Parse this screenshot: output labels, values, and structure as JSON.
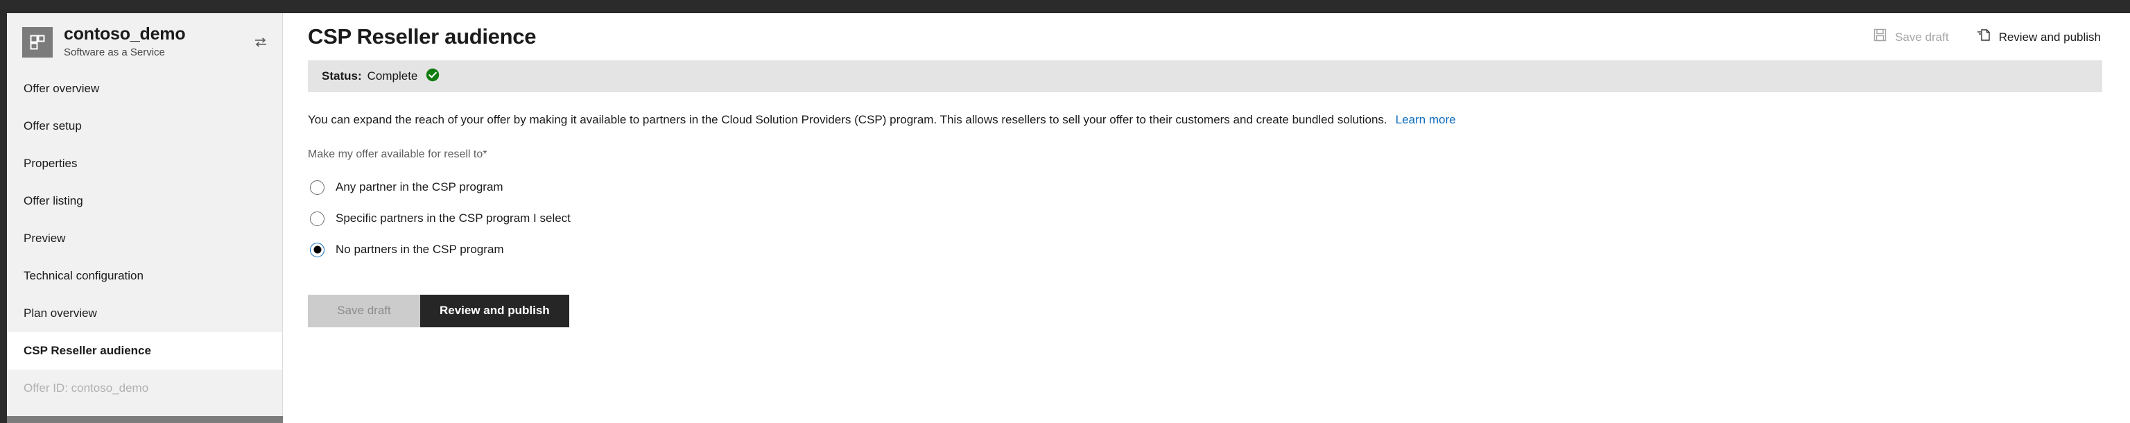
{
  "sidebar": {
    "app_icon_name": "offer-grid-icon",
    "app_name": "contoso_demo",
    "app_subtitle": "Software as a Service",
    "collapse_icon_name": "collapse-panel-icon",
    "items": [
      {
        "label": "Offer overview",
        "selected": false,
        "muted": false
      },
      {
        "label": "Offer setup",
        "selected": false,
        "muted": false
      },
      {
        "label": "Properties",
        "selected": false,
        "muted": false
      },
      {
        "label": "Offer listing",
        "selected": false,
        "muted": false
      },
      {
        "label": "Preview",
        "selected": false,
        "muted": false
      },
      {
        "label": "Technical configuration",
        "selected": false,
        "muted": false
      },
      {
        "label": "Plan overview",
        "selected": false,
        "muted": false
      },
      {
        "label": "CSP Reseller audience",
        "selected": true,
        "muted": false
      },
      {
        "label": "Offer ID: contoso_demo",
        "selected": false,
        "muted": true
      }
    ]
  },
  "header": {
    "title": "CSP Reseller audience",
    "save_draft_label": "Save draft",
    "save_draft_icon": "save-floppy-icon",
    "review_publish_label": "Review and publish",
    "review_publish_icon": "publish-document-icon"
  },
  "status": {
    "label": "Status:",
    "value": "Complete",
    "icon_name": "green-check-circle-icon",
    "color": "#107c10"
  },
  "main": {
    "description": "You can expand the reach of your offer by making it available to partners in the Cloud Solution Providers (CSP) program. This allows resellers to sell your offer to their customers and create bundled solutions.",
    "learn_more_label": "Learn more",
    "field_label": "Make my offer available for resell to",
    "required_marker": "*",
    "radio_options": [
      {
        "label": "Any partner in the CSP program",
        "checked": false
      },
      {
        "label": "Specific partners in the CSP program I select",
        "checked": false
      },
      {
        "label": "No partners in the CSP program",
        "checked": true
      }
    ],
    "save_draft_button": "Save draft",
    "review_publish_button": "Review and publish"
  },
  "colors": {
    "accent": "#0f6cbd",
    "status_green": "#107c10",
    "primary_button": "#262626",
    "chrome_dark": "#2b2b2b"
  }
}
